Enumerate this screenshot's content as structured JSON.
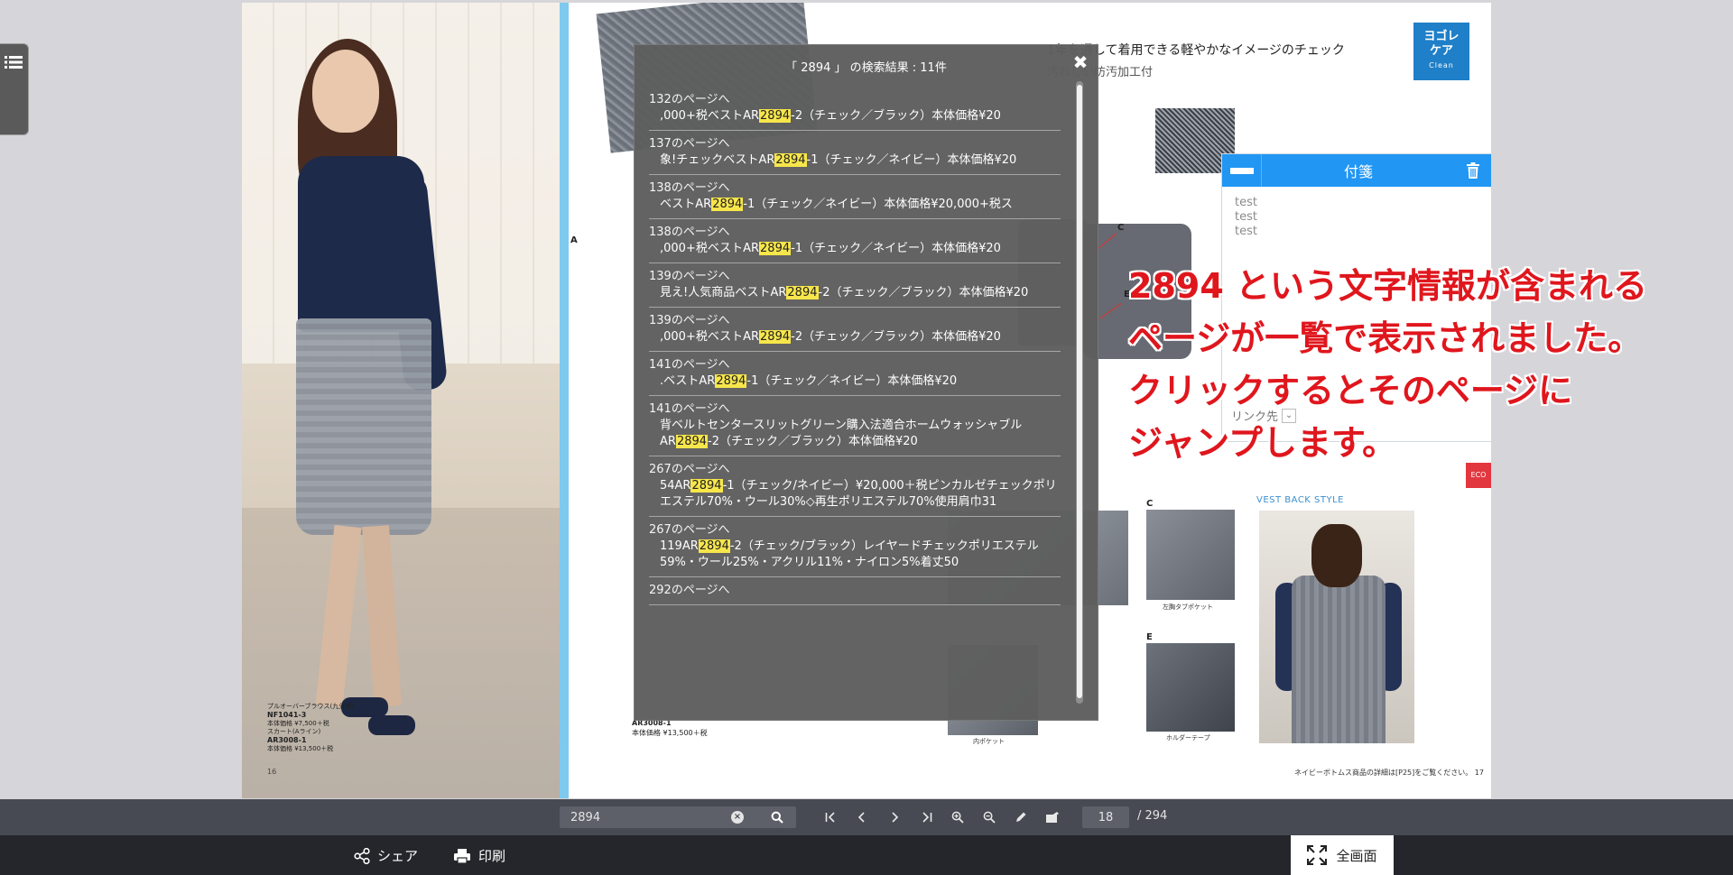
{
  "results_popup": {
    "title": "「 2894 」 の検索結果 : 11件",
    "items": [
      {
        "page": "132のページへ",
        "before": ",000+税ベストAR",
        "hit": "2894",
        "after": "-2（チェック／ブラック）本体価格¥20"
      },
      {
        "page": "137のページへ",
        "before": "象!チェックベストAR",
        "hit": "2894",
        "after": "-1（チェック／ネイビー）本体価格¥20"
      },
      {
        "page": "138のページへ",
        "before": "ベストAR",
        "hit": "2894",
        "after": "-1（チェック／ネイビー）本体価格¥20,000+税ス"
      },
      {
        "page": "138のページへ",
        "before": ",000+税ベストAR",
        "hit": "2894",
        "after": "-1（チェック／ネイビー）本体価格¥20"
      },
      {
        "page": "139のページへ",
        "before": "見え!人気商品ベストAR",
        "hit": "2894",
        "after": "-2（チェック／ブラック）本体価格¥20"
      },
      {
        "page": "139のページへ",
        "before": ",000+税ベストAR",
        "hit": "2894",
        "after": "-2（チェック／ブラック）本体価格¥20"
      },
      {
        "page": "141のページへ",
        "before": ".ベストAR",
        "hit": "2894",
        "after": "-1（チェック／ネイビー）本体価格¥20"
      },
      {
        "page": "141のページへ",
        "before": "背ベルトセンタースリットグリーン購入法適合ホームウォッシャブルAR",
        "hit": "2894",
        "after": "-2（チェック／ブラック）本体価格¥20"
      },
      {
        "page": "267のページへ",
        "before": "54AR",
        "hit": "2894",
        "after": "-1（チェック/ネイビー）¥20,000＋税ピンカルゼチェックポリエステル70%・ウール30%◇再生ポリエステル70%使用肩巾31"
      },
      {
        "page": "267のページへ",
        "before": "119AR",
        "hit": "2894",
        "after": "-2（チェック/ブラック）レイヤードチェックポリエステル59%・ウール25%・アクリル11%・ナイロン5%着丈50"
      },
      {
        "page": "292のページへ",
        "before": "",
        "hit": "",
        "after": ""
      }
    ]
  },
  "sticky_note": {
    "title": "付箋",
    "body": "test\ntest\ntest",
    "link_label": "リンク先"
  },
  "annotation": {
    "lines": [
      "2894 という文字情報が含まれる",
      "ページが一覧で表示されました。",
      "クリックするとそのページに",
      "ジャンプします。"
    ],
    "color": "#e0161d"
  },
  "catalog": {
    "headline": "1年を通して着用できる軽やかなイメージのチェック",
    "subline": "汚れしい防汚加工付",
    "logo_line1": "ヨゴレ",
    "logo_line2": "ケア",
    "logo_sub": "Clean",
    "vest_back_label": "VEST BACK STYLE",
    "eco": "ECO",
    "footer_note": "ネイビーボトムス商品の詳細は[P25]をご覧ください。 17",
    "left_caption_1": "プルオーバーブラウス(九分袖)",
    "left_caption_2": "NF1041-3",
    "left_caption_3": "本体価格 ¥7,500＋税",
    "left_caption_4": "スカート(Aライン)",
    "left_caption_5": "AR3008-1",
    "left_caption_6": "本体価格 ¥13,500＋税",
    "left_page_num": "16",
    "price_label_1": "AR3008-1",
    "price_label_2": "本体価格 ¥13,500＋税",
    "letter_a": "A",
    "letter_c": "C",
    "letter_e": "E",
    "caption_pocket": "左胸タブポケット",
    "caption_inner": "内ポケット",
    "caption_holder": "ホルダーテープ"
  },
  "toolbar": {
    "search_value": "2894",
    "current_page": "18",
    "total_pages": "/ 294"
  },
  "footer": {
    "share_label": "シェア",
    "print_label": "印刷",
    "fullscreen_label": "全画面"
  },
  "colors": {
    "toolbar_bg": "#474a52",
    "footer_bg": "#24262b",
    "accent_blue": "#2196f3",
    "highlight": "#f7e64b"
  }
}
